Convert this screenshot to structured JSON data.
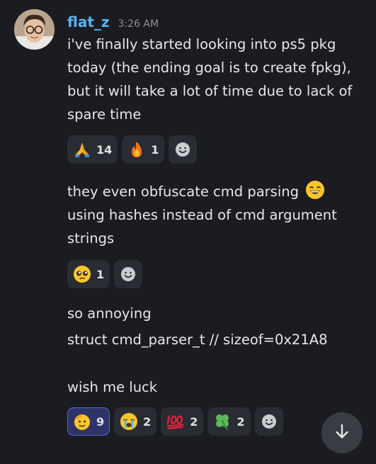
{
  "message": {
    "username": "flat_z",
    "timestamp": "3:26 AM",
    "groups": [
      {
        "lines": [
          "i've finally started looking into ps5 pkg",
          "today (the ending goal is to create fpkg),",
          "but it will take a lot of time due to lack of",
          "spare time"
        ],
        "reactions": [
          {
            "emoji": "folded-hands-icon",
            "count": "14"
          },
          {
            "emoji": "fire-icon",
            "count": "1"
          }
        ]
      },
      {
        "lines": [
          "they even obfuscate cmd parsing",
          "using hashes instead of cmd argument",
          "strings"
        ],
        "reactions": [
          {
            "emoji": "pleading-face-icon",
            "count": "1"
          }
        ]
      },
      {
        "lines": [
          "so annoying",
          "struct cmd_parser_t // sizeof=0x21A8",
          "",
          "wish me luck"
        ],
        "reactions": [
          {
            "emoji": "saluting-face-icon",
            "count": "9"
          },
          {
            "emoji": "crying-face-icon",
            "count": "2"
          },
          {
            "emoji": "hundred-points-icon",
            "count": "2"
          },
          {
            "emoji": "four-leaf-clover-icon",
            "count": "2"
          }
        ]
      }
    ]
  }
}
